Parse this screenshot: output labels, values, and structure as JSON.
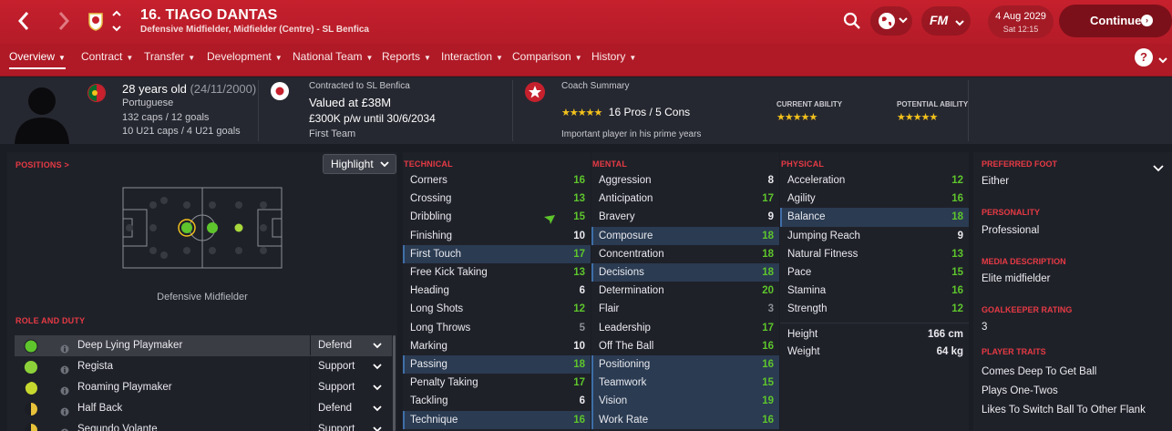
{
  "header": {
    "title": "16. TIAGO DANTAS",
    "subtitle": "Defensive Midfielder, Midfielder (Centre) - SL Benfica",
    "date": "4 Aug 2029",
    "time": "Sat 12:15",
    "continue_label": "Continue",
    "fm_label": "FM"
  },
  "tabs": [
    {
      "label": "Overview"
    },
    {
      "label": "Contract"
    },
    {
      "label": "Transfer"
    },
    {
      "label": "Development"
    },
    {
      "label": "National Team"
    },
    {
      "label": "Reports"
    },
    {
      "label": "Interaction"
    },
    {
      "label": "Comparison"
    },
    {
      "label": "History"
    }
  ],
  "profile": {
    "age": "28 years old",
    "dob": "(24/11/2000)",
    "nationality": "Portuguese",
    "caps": "132 caps / 12 goals",
    "u21_caps": "10 U21 caps / 4 U21 goals",
    "contract_label": "Contracted to SL Benfica",
    "value": "Valued at £38M",
    "wage": "£300K p/w until 30/6/2034",
    "squad": "First Team",
    "coach_label": "Coach Summary",
    "pros_cons": "16 Pros / 5 Cons",
    "coach_note": "Important player in his prime years",
    "current_ability_label": "CURRENT ABILITY",
    "potential_ability_label": "POTENTIAL ABILITY",
    "stars": "★★★★★",
    "star_rating": 5
  },
  "positions": {
    "label": "POSITIONS >",
    "highlight_label": "Highlight",
    "position_name": "Defensive Midfielder"
  },
  "role_duty": {
    "label": "ROLE AND DUTY",
    "roles": [
      {
        "name": "Deep Lying Playmaker",
        "duty": "Defend"
      },
      {
        "name": "Regista",
        "duty": "Support"
      },
      {
        "name": "Roaming Playmaker",
        "duty": "Support"
      },
      {
        "name": "Half Back",
        "duty": "Defend"
      },
      {
        "name": "Segundo Volante",
        "duty": "Support"
      }
    ]
  },
  "technical": {
    "label": "TECHNICAL",
    "attributes": [
      {
        "name": "Corners",
        "value": "16"
      },
      {
        "name": "Crossing",
        "value": "13"
      },
      {
        "name": "Dribbling",
        "value": "15"
      },
      {
        "name": "Finishing",
        "value": "10"
      },
      {
        "name": "First Touch",
        "value": "17"
      },
      {
        "name": "Free Kick Taking",
        "value": "13"
      },
      {
        "name": "Heading",
        "value": "6"
      },
      {
        "name": "Long Shots",
        "value": "12"
      },
      {
        "name": "Long Throws",
        "value": "5"
      },
      {
        "name": "Marking",
        "value": "10"
      },
      {
        "name": "Passing",
        "value": "18"
      },
      {
        "name": "Penalty Taking",
        "value": "17"
      },
      {
        "name": "Tackling",
        "value": "6"
      },
      {
        "name": "Technique",
        "value": "16"
      }
    ]
  },
  "mental": {
    "label": "MENTAL",
    "attributes": [
      {
        "name": "Aggression",
        "value": "8"
      },
      {
        "name": "Anticipation",
        "value": "17"
      },
      {
        "name": "Bravery",
        "value": "9"
      },
      {
        "name": "Composure",
        "value": "18"
      },
      {
        "name": "Concentration",
        "value": "18"
      },
      {
        "name": "Decisions",
        "value": "18"
      },
      {
        "name": "Determination",
        "value": "20"
      },
      {
        "name": "Flair",
        "value": "3"
      },
      {
        "name": "Leadership",
        "value": "17"
      },
      {
        "name": "Off The Ball",
        "value": "16"
      },
      {
        "name": "Positioning",
        "value": "16"
      },
      {
        "name": "Teamwork",
        "value": "15"
      },
      {
        "name": "Vision",
        "value": "19"
      },
      {
        "name": "Work Rate",
        "value": "16"
      }
    ]
  },
  "physical": {
    "label": "PHYSICAL",
    "attributes": [
      {
        "name": "Acceleration",
        "value": "12"
      },
      {
        "name": "Agility",
        "value": "16"
      },
      {
        "name": "Balance",
        "value": "18"
      },
      {
        "name": "Jumping Reach",
        "value": "9"
      },
      {
        "name": "Natural Fitness",
        "value": "13"
      },
      {
        "name": "Pace",
        "value": "15"
      },
      {
        "name": "Stamina",
        "value": "16"
      },
      {
        "name": "Strength",
        "value": "12"
      }
    ],
    "height_label": "Height",
    "height": "166 cm",
    "weight_label": "Weight",
    "weight": "64 kg"
  },
  "side": {
    "preferred_foot_label": "PREFERRED FOOT",
    "preferred_foot": "Either",
    "personality_label": "PERSONALITY",
    "personality": "Professional",
    "media_label": "MEDIA DESCRIPTION",
    "media": "Elite midfielder",
    "gk_label": "GOALKEEPER RATING",
    "gk": "3",
    "traits_label": "PLAYER TRAITS",
    "traits": [
      "Comes Deep To Get Ball",
      "Plays One-Twos",
      "Likes To Switch Ball To Other Flank"
    ]
  },
  "colors": {
    "accent": "#c6202d",
    "green": "#5ec52c",
    "star": "#f3c21c"
  }
}
